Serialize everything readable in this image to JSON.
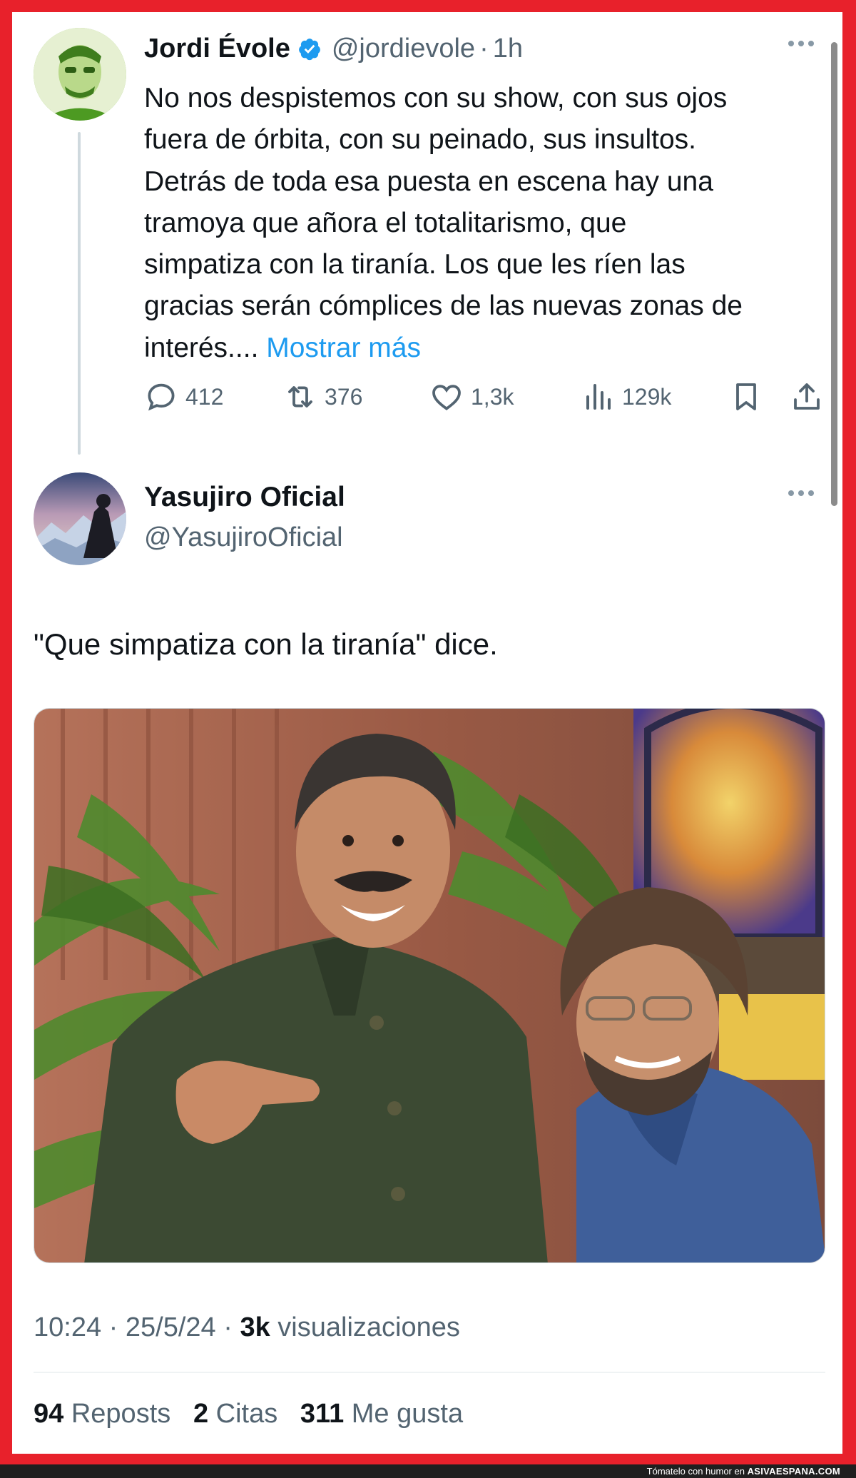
{
  "tweet1": {
    "display_name": "Jordi Évole",
    "handle": "@jordievole",
    "separator": "·",
    "time": "1h",
    "text_lines": [
      "No nos despistemos con su show, con sus ojos",
      "fuera de órbita, con su peinado, sus insultos.",
      "Detrás de toda esa puesta en escena hay una",
      "tramoya que añora el totalitarismo, que",
      "simpatiza con la tiranía. Los que les ríen las",
      "gracias serán cómplices de las nuevas zonas de",
      "interés...."
    ],
    "show_more": "Mostrar más",
    "replies": "412",
    "reposts": "376",
    "likes": "1,3k",
    "views": "129k"
  },
  "tweet2": {
    "display_name": "Yasujiro Oficial",
    "handle": "@YasujiroOficial",
    "text": "\"Que simpatiza con la tiranía\" dice.",
    "time": "10:24",
    "separator": "·",
    "date": "25/5/24",
    "views_count": "3k",
    "views_label": "visualizaciones",
    "reposts_count": "94",
    "reposts_label": "Reposts",
    "quotes_count": "2",
    "quotes_label": "Citas",
    "likes_count": "311",
    "likes_label": "Me gusta"
  },
  "footer": {
    "text": "Tómatelo con humor en",
    "brand": "ASIVAESPANA.COM"
  },
  "colors": {
    "frame_red": "#e8212b",
    "link_blue": "#1d9bf0",
    "secondary_gray": "#536471"
  }
}
